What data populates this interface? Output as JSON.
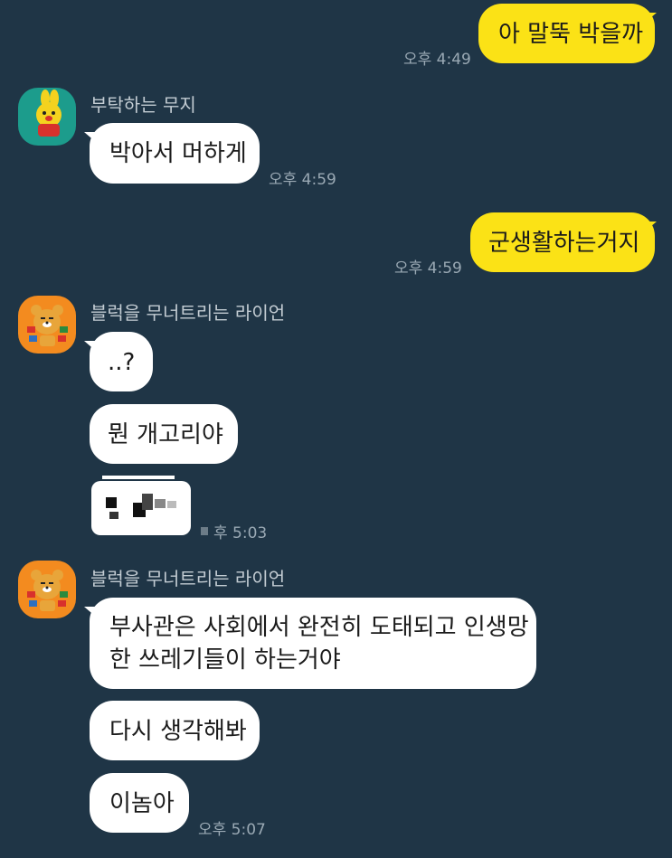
{
  "colors": {
    "background": "#1f3546",
    "my_bubble": "#fbe216",
    "their_bubble": "#ffffff",
    "muzi_bg": "#1c9c8c",
    "ryan_bg": "#f38b1f"
  },
  "messages": {
    "m1": {
      "text": "아 말뚝 박을까",
      "time": "오후 4:49"
    },
    "m2_sender": "부탁하는 무지",
    "m2": {
      "text": "박아서 머하게",
      "time": "오후 4:59"
    },
    "m3": {
      "text": "군생활하는거지",
      "time": "오후 4:59"
    },
    "m4_sender": "블럭을 무너트리는 라이언",
    "m4a": {
      "text": "..?"
    },
    "m4b": {
      "text": "뭔 개고리야"
    },
    "m4c": {
      "time": "후 5:03"
    },
    "m5_sender": "블럭을 무너트리는 라이언",
    "m5a": {
      "line1": "부사관은 사회에서 완전히 도태되고 인생망",
      "line2": "한 쓰레기들이 하는거야"
    },
    "m5b": {
      "text": "다시 생각해봐"
    },
    "m5c": {
      "text": "이놈아",
      "time": "오후 5:07"
    }
  },
  "avatars": {
    "muzi": "muzi-avatar",
    "ryan": "ryan-avatar"
  }
}
